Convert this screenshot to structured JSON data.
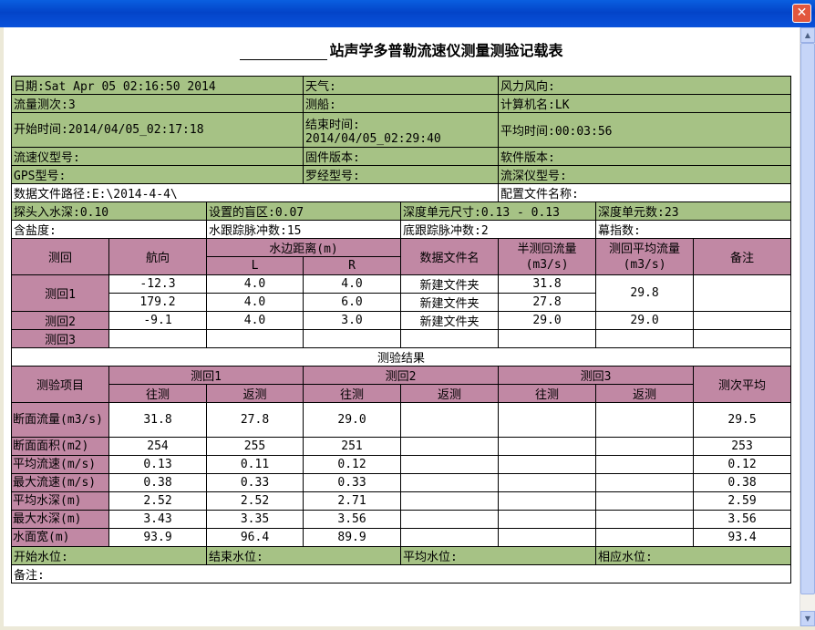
{
  "window": {
    "close_glyph": "✕"
  },
  "title": {
    "blank": "",
    "text": "站声学多普勒流速仪测量测验记载表"
  },
  "info": [
    [
      {
        "label": "日期:",
        "value": "Sat Apr 05 02:16:50 2014"
      },
      {
        "label": "天气:",
        "value": ""
      },
      {
        "label": "风力风向:",
        "value": ""
      }
    ],
    [
      {
        "label": "流量测次:",
        "value": "3"
      },
      {
        "label": "测船:",
        "value": ""
      },
      {
        "label": "计算机名:",
        "value": "LK"
      }
    ],
    [
      {
        "label": "开始时间:",
        "value": "2014/04/05_02:17:18"
      },
      {
        "label": "结束时间:",
        "value": "2014/04/05_02:29:40"
      },
      {
        "label": "平均时间:",
        "value": "00:03:56"
      }
    ],
    [
      {
        "label": "流速仪型号:",
        "value": ""
      },
      {
        "label": "固件版本:",
        "value": ""
      },
      {
        "label": "软件版本:",
        "value": ""
      }
    ],
    [
      {
        "label": "GPS型号:",
        "value": ""
      },
      {
        "label": "罗经型号:",
        "value": ""
      },
      {
        "label": "流深仪型号:",
        "value": ""
      }
    ]
  ],
  "data_path": {
    "label": "数据文件路径:",
    "value": "E:\\2014-4-4\\"
  },
  "config_file": {
    "label": "配置文件名称:",
    "value": ""
  },
  "params": [
    [
      {
        "label": "探头入水深:",
        "value": "0.10"
      },
      {
        "label": "设置的盲区:",
        "value": "0.07"
      },
      {
        "label": "深度单元尺寸:",
        "value": "0.13 - 0.13"
      },
      {
        "label": "深度单元数:",
        "value": "23"
      }
    ],
    [
      {
        "label": "含盐度:",
        "value": ""
      },
      {
        "label": "水跟踪脉冲数:",
        "value": "15"
      },
      {
        "label": "底跟踪脉冲数:",
        "value": "2"
      },
      {
        "label": "幕指数:",
        "value": ""
      }
    ]
  ],
  "header": {
    "round": "测回",
    "heading": "航向",
    "edge": "水边距离(m)",
    "L": "L",
    "R": "R",
    "file": "数据文件名",
    "half_flow": "半测回流量(m3/s)",
    "avg_flow": "测回平均流量(m3/s)",
    "remark": "备注"
  },
  "rounds": [
    {
      "label": "测回1",
      "avg": "29.8",
      "rows": [
        {
          "heading": "-12.3",
          "L": "4.0",
          "R": "4.0",
          "file": "新建文件夹",
          "flow": "31.8"
        },
        {
          "heading": "179.2",
          "L": "4.0",
          "R": "6.0",
          "file": "新建文件夹",
          "flow": "27.8"
        }
      ]
    },
    {
      "label": "测回2",
      "avg": "29.0",
      "rows": [
        {
          "heading": "-9.1",
          "L": "4.0",
          "R": "3.0",
          "file": "新建文件夹",
          "flow": "29.0"
        }
      ]
    },
    {
      "label": "测回3",
      "avg": "",
      "rows": []
    }
  ],
  "results": {
    "title": "测验结果",
    "item_header": "测验项目",
    "round_headers": [
      "测回1",
      "测回2",
      "测回3"
    ],
    "dir_labels": [
      "往测",
      "返测"
    ],
    "avg_header": "测次平均",
    "rows": [
      {
        "label": "断面流量(m3/s)",
        "v": [
          "31.8",
          "27.8",
          "29.0",
          "",
          "",
          ""
        ],
        "avg": "29.5"
      },
      {
        "label": "断面面积(m2)",
        "v": [
          "254",
          "255",
          "251",
          "",
          "",
          ""
        ],
        "avg": "253"
      },
      {
        "label": "平均流速(m/s)",
        "v": [
          "0.13",
          "0.11",
          "0.12",
          "",
          "",
          ""
        ],
        "avg": "0.12"
      },
      {
        "label": "最大流速(m/s)",
        "v": [
          "0.38",
          "0.33",
          "0.33",
          "",
          "",
          ""
        ],
        "avg": "0.38"
      },
      {
        "label": "平均水深(m)",
        "v": [
          "2.52",
          "2.52",
          "2.71",
          "",
          "",
          ""
        ],
        "avg": "2.59"
      },
      {
        "label": "最大水深(m)",
        "v": [
          "3.43",
          "3.35",
          "3.56",
          "",
          "",
          ""
        ],
        "avg": "3.56"
      },
      {
        "label": "水面宽(m)",
        "v": [
          "93.9",
          "96.4",
          "89.9",
          "",
          "",
          ""
        ],
        "avg": "93.4"
      }
    ]
  },
  "water_levels": [
    {
      "label": "开始水位:",
      "value": ""
    },
    {
      "label": "结束水位:",
      "value": ""
    },
    {
      "label": "平均水位:",
      "value": ""
    },
    {
      "label": "相应水位:",
      "value": ""
    }
  ],
  "remarks": {
    "label": "备注:",
    "value": ""
  },
  "scrollbar": {
    "up_glyph": "▲",
    "down_glyph": "▼"
  }
}
